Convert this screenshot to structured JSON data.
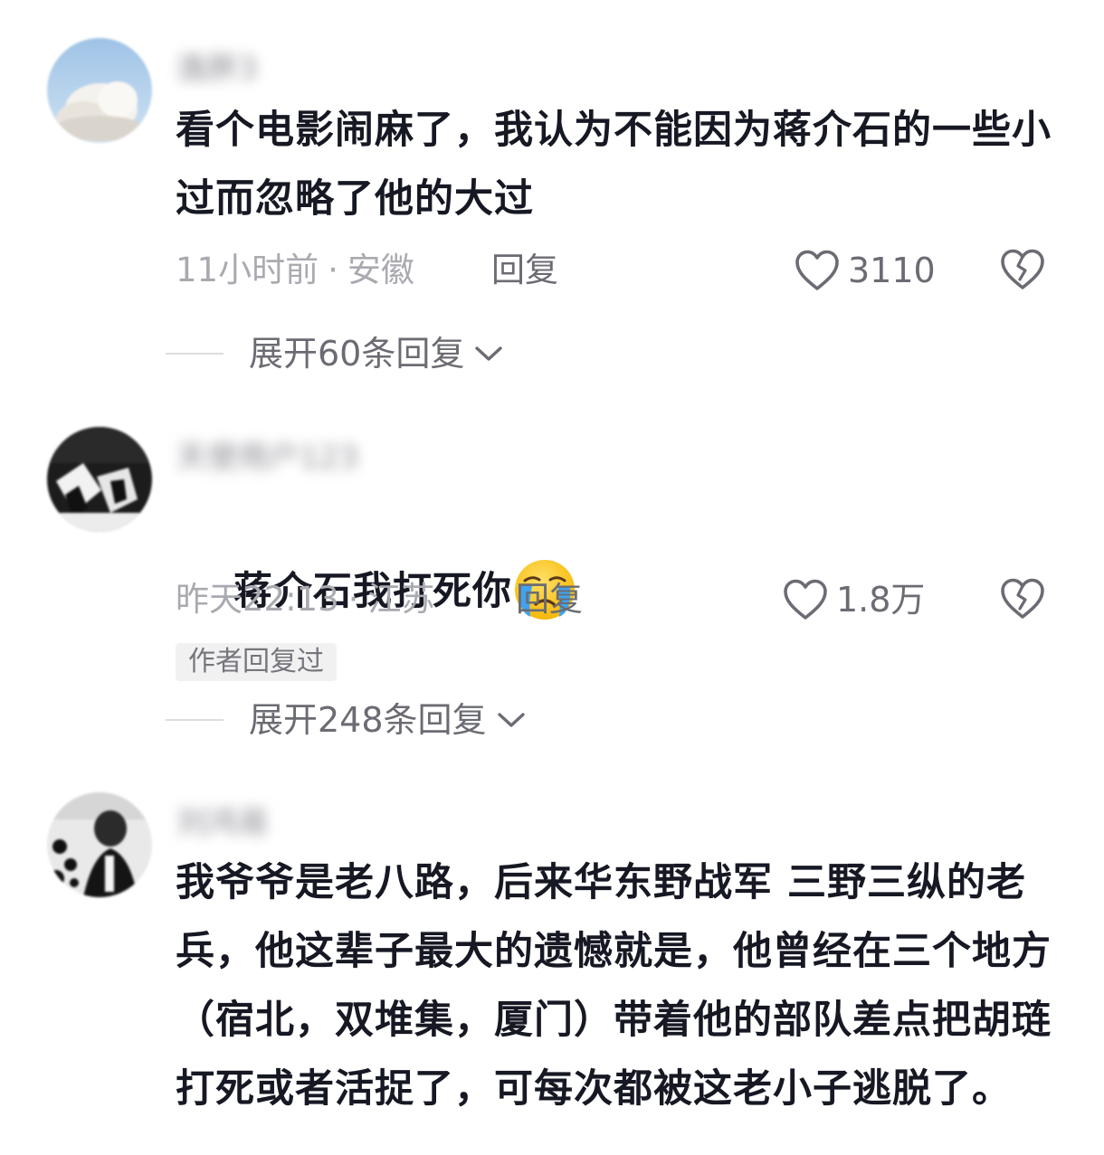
{
  "comments": [
    {
      "username": "逸胖3",
      "text": "看个电影闹麻了，我认为不能因为蒋介石的一些小过而忽略了他的大过",
      "time": "11小时前",
      "location": "安徽",
      "reply_label": "回复",
      "likes": "3110",
      "expand_label": "展开60条回复"
    },
    {
      "username": "天使用户123",
      "text": "蒋介石我打死你",
      "emoji": "crying-face",
      "time": "昨天22:13",
      "location": "江苏",
      "reply_label": "回复",
      "likes": "1.8万",
      "badge": "作者回复过",
      "expand_label": "展开248条回复"
    },
    {
      "username": "刘鸿易",
      "text": "我爷爷是老八路，后来华东野战军 三野三纵的老兵，他这辈子最大的遗憾就是，他曾经在三个地方（宿北，双堆集，厦门）带着他的部队差点把胡琏打死或者活捉了，可每次都被这老小子逃脱了。"
    }
  ],
  "colors": {
    "text": "#161823",
    "meta": "#a9aab0",
    "secondary": "#6b6c73",
    "badge_bg": "#f1f1f2"
  },
  "icons": [
    "heart-outline-icon",
    "broken-heart-icon",
    "chevron-down-icon",
    "crying-face-emoji"
  ]
}
